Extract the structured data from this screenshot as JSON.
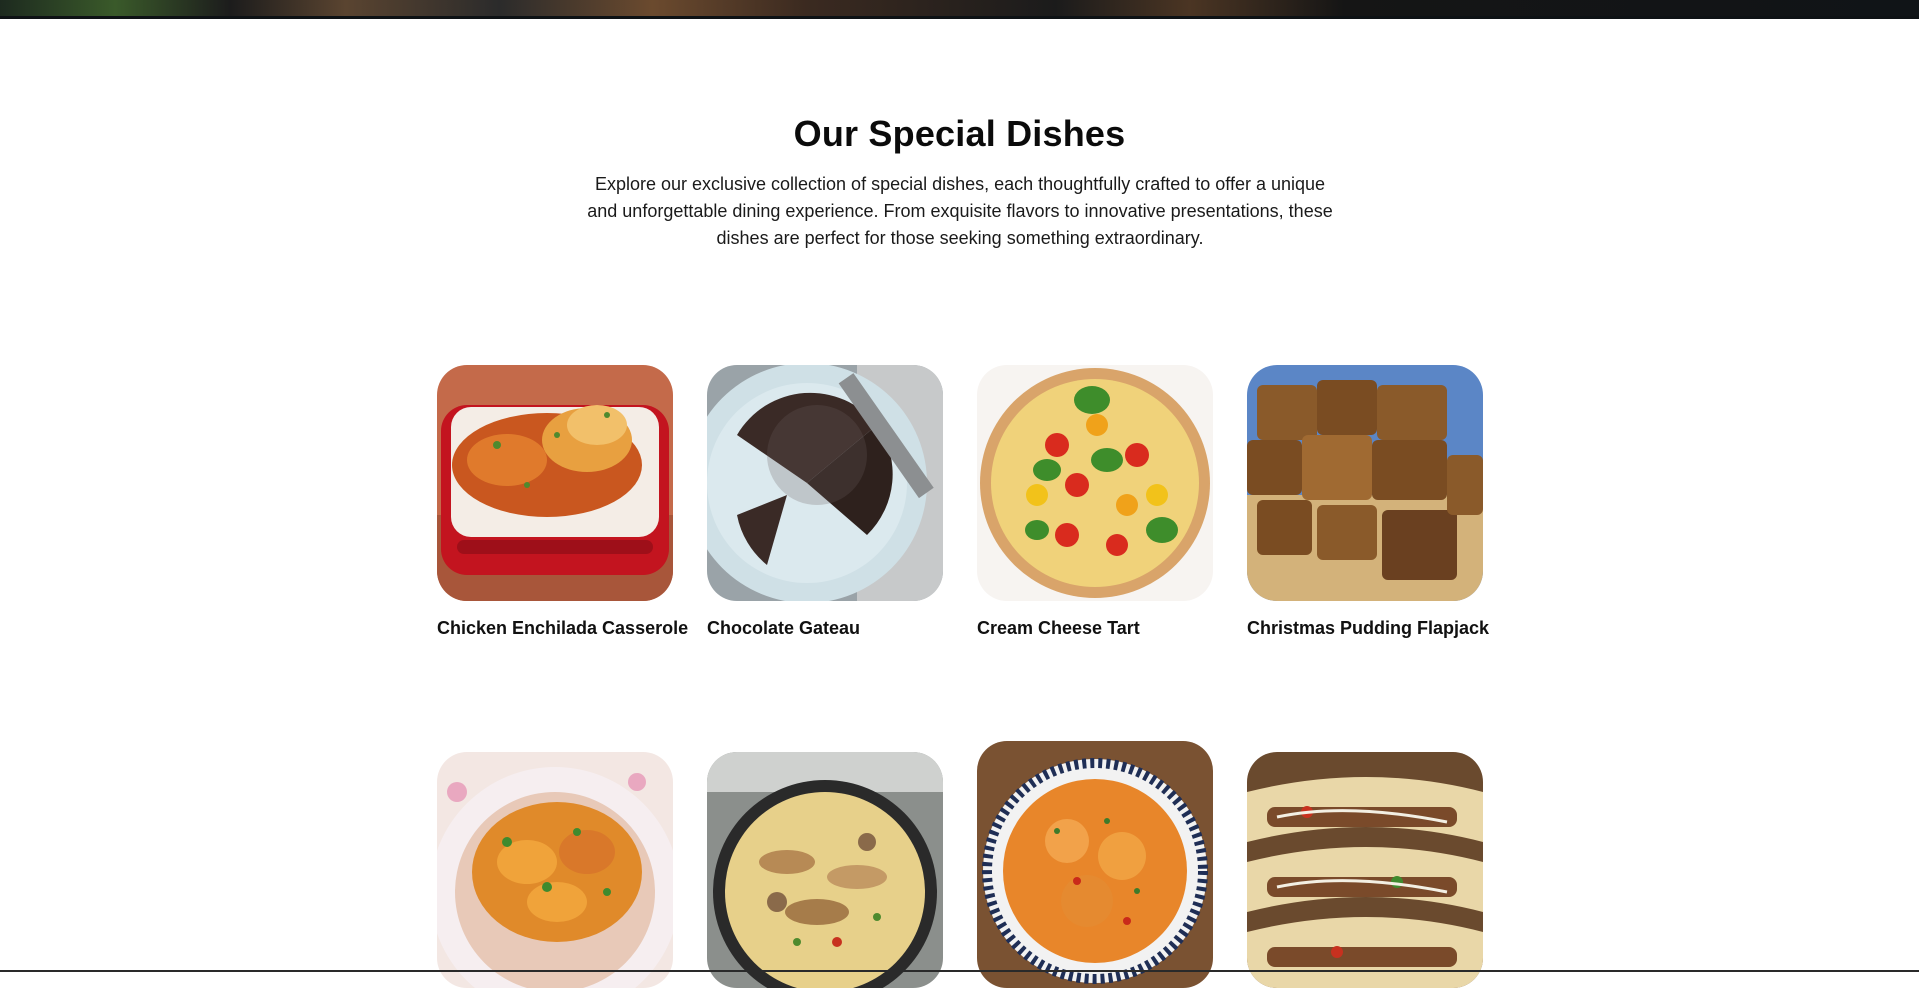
{
  "section": {
    "title": "Our Special Dishes",
    "description": "Explore our exclusive collection of special dishes, each thoughtfully crafted to offer a unique and unforgettable dining experience. From exquisite flavors to innovative presentations, these dishes are perfect for those seeking something extraordinary."
  },
  "dishes": [
    {
      "name": "Chicken Enchilada Casserole"
    },
    {
      "name": "Chocolate Gateau"
    },
    {
      "name": "Cream Cheese Tart"
    },
    {
      "name": "Christmas Pudding Flapjack"
    },
    {
      "name": ""
    },
    {
      "name": ""
    },
    {
      "name": ""
    },
    {
      "name": ""
    }
  ],
  "colors": {
    "background": "#ffffff",
    "text": "#111111",
    "banner": "#1c1c1c"
  }
}
